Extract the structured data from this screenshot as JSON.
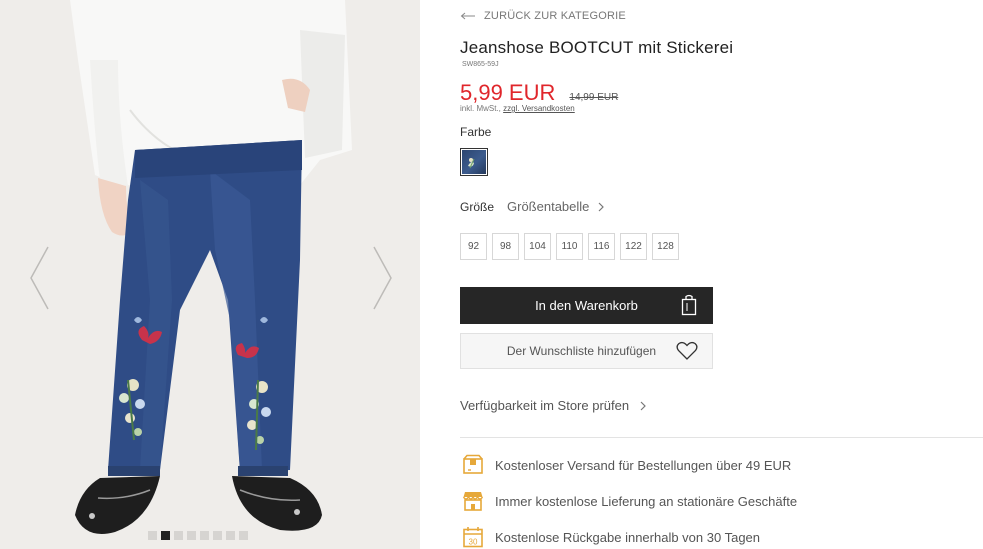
{
  "gallery": {
    "prev_icon": "chevron-left-icon",
    "next_icon": "chevron-right-icon",
    "dots_total": 8,
    "active_dot": 2
  },
  "nav": {
    "back_label": "ZURÜCK ZUR KATEGORIE",
    "back_icon": "arrow-left-icon"
  },
  "product": {
    "title": "Jeanshose BOOTCUT mit Stickerei",
    "sku": "SW865-59J",
    "price": "5,99 EUR",
    "old_price": "14,99 EUR",
    "tax_prefix": "inkl. MwSt.,",
    "tax_link": "zzgl. Versandkosten",
    "price_color": "#e0262b"
  },
  "color": {
    "label": "Farbe"
  },
  "size": {
    "label": "Größe",
    "table_label": "Größentabelle",
    "options": [
      "92",
      "98",
      "104",
      "110",
      "116",
      "122",
      "128"
    ]
  },
  "actions": {
    "cart_label": "In den Warenkorb",
    "cart_icon": "shopping-bag-icon",
    "wishlist_label": "Der Wunschliste hinzufügen",
    "wishlist_icon": "heart-icon",
    "store_check_label": "Verfügbarkeit im Store prüfen"
  },
  "benefits": [
    {
      "icon": "shipping-box-icon",
      "text": "Kostenloser Versand für Bestellungen über 49 EUR"
    },
    {
      "icon": "store-icon",
      "text": "Immer kostenlose Lieferung an stationäre Geschäfte"
    },
    {
      "icon": "calendar-30-icon",
      "text": "Kostenlose Rückgabe innerhalb von 30 Tagen",
      "badge": "30"
    }
  ],
  "colors": {
    "accent": "#e6a83a",
    "dark_button": "#262626"
  }
}
